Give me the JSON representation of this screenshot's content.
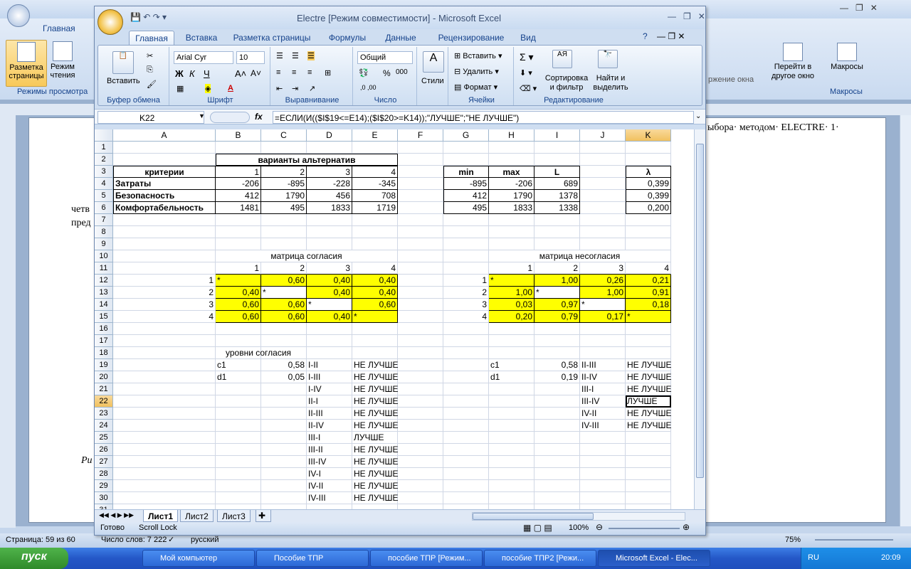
{
  "word": {
    "tab_home": "Главная",
    "layout_btn": "Разметка страницы",
    "reading_btn": "Режим чтения",
    "views_group": "Режимы просмотра",
    "goto_btn": "Перейти в другое окно",
    "window_fragment": "ржение окна",
    "macros_btn": "Макросы",
    "macros_group": "Макросы",
    "doc_text_right": "ыбора· методом· ELECTRE· 1·",
    "doc_text_left1": "четв",
    "doc_text_left2": "пред",
    "doc_text_ri": "Ри",
    "status_page": "Страница: 59 из 60",
    "status_words": "Число слов: 7 222",
    "status_lang": "русский",
    "zoom": "75%"
  },
  "excel": {
    "title": "Electre  [Режим совместимости] - Microsoft Excel",
    "tabs": [
      "Главная",
      "Вставка",
      "Разметка страницы",
      "Формулы",
      "Данные",
      "Рецензирование",
      "Вид"
    ],
    "ribbon": {
      "paste": "Вставить",
      "clipboard": "Буфер обмена",
      "font_name": "Arial Cyr",
      "font_size": "10",
      "font_group": "Шрифт",
      "align_group": "Выравнивание",
      "number_format": "Общий",
      "number_group": "Число",
      "styles": "Стили",
      "insert": "Вставить",
      "delete": "Удалить",
      "format": "Формат",
      "cells_group": "Ячейки",
      "sort": "Сортировка и фильтр",
      "find": "Найти и выделить",
      "edit_group": "Редактирование"
    },
    "name_box": "K22",
    "formula": "=ЕСЛИ(И(($I$19<=E14);($I$20>=K14));\"ЛУЧШЕ\";\"НЕ ЛУЧШЕ\")",
    "columns": [
      "A",
      "B",
      "C",
      "D",
      "E",
      "F",
      "G",
      "H",
      "I",
      "J",
      "K"
    ],
    "rows": [
      "1",
      "2",
      "3",
      "4",
      "5",
      "6",
      "7",
      "8",
      "9",
      "10",
      "11",
      "12",
      "13",
      "14",
      "15",
      "16",
      "17",
      "18",
      "19",
      "20",
      "21",
      "22",
      "23",
      "24",
      "25",
      "26",
      "27",
      "28",
      "29",
      "30",
      "31"
    ],
    "cells": {
      "B2": "варианты альтернатив",
      "A3": "критерии",
      "B3": "1",
      "C3": "2",
      "D3": "3",
      "E3": "4",
      "G3": "min",
      "H3": "max",
      "I3": "L",
      "K3": "λ",
      "A4": "Затраты",
      "B4": "-206",
      "C4": "-895",
      "D4": "-228",
      "E4": "-345",
      "G4": "-895",
      "H4": "-206",
      "I4": "689",
      "K4": "0,399",
      "A5": "Безопасность",
      "B5": "412",
      "C5": "1790",
      "D5": "456",
      "E5": "708",
      "G5": "412",
      "H5": "1790",
      "I5": "1378",
      "K5": "0,399",
      "A6": "Комфортабельность",
      "B6": "1481",
      "C6": "495",
      "D6": "1833",
      "E6": "1719",
      "G6": "495",
      "H6": "1833",
      "I6": "1338",
      "K6": "0,200",
      "C10": "матрица согласия",
      "I10": "матрица несогласия",
      "B11": "1",
      "C11": "2",
      "D11": "3",
      "E11": "4",
      "H11": "1",
      "I11": "2",
      "J11": "3",
      "K11": "4",
      "A12": "1",
      "B12": "*",
      "C12": "0,60",
      "D12": "0,40",
      "E12": "0,40",
      "G12": "1",
      "H12": "*",
      "I12": "1,00",
      "J12": "0,26",
      "K12": "0,21",
      "A13": "2",
      "B13": "0,40",
      "C13": "*",
      "D13": "0,40",
      "E13": "0,40",
      "G13": "2",
      "H13": "1,00",
      "I13": "*",
      "J13": "1,00",
      "K13": "0,91",
      "A14": "3",
      "B14": "0,60",
      "C14": "0,60",
      "D14": "*",
      "E14": "0,60",
      "G14": "3",
      "H14": "0,03",
      "I14": "0,97",
      "J14": "*",
      "K14": "0,18",
      "A15": "4",
      "B15": "0,60",
      "C15": "0,60",
      "D15": "0,40",
      "E15": "*",
      "G15": "4",
      "H15": "0,20",
      "I15": "0,79",
      "J15": "0,17",
      "K15": "*",
      "B18": "уровни согласия",
      "B19": "c1",
      "C19": "0,58",
      "D19": "I-II",
      "E19": "НЕ ЛУЧШЕ",
      "H19": "c1",
      "I19": "0,58",
      "J19": "II-III",
      "K19": "НЕ ЛУЧШЕ",
      "B20": "d1",
      "C20": "0,05",
      "D20": "I-III",
      "E20": "НЕ ЛУЧШЕ",
      "H20": "d1",
      "I20": "0,19",
      "J20": "II-IV",
      "K20": "НЕ ЛУЧШЕ",
      "D21": "I-IV",
      "E21": "НЕ ЛУЧШЕ",
      "J21": "III-I",
      "K21": "НЕ ЛУЧШЕ",
      "D22": "II-I",
      "E22": "НЕ ЛУЧШЕ",
      "J22": "III-IV",
      "K22": "ЛУЧШЕ",
      "D23": "II-III",
      "E23": "НЕ ЛУЧШЕ",
      "J23": "IV-II",
      "K23": "НЕ ЛУЧШЕ",
      "D24": "II-IV",
      "E24": "НЕ ЛУЧШЕ",
      "J24": "IV-III",
      "K24": "НЕ ЛУЧШЕ",
      "D25": "III-I",
      "E25": "ЛУЧШЕ",
      "D26": "III-II",
      "E26": "НЕ ЛУЧШЕ",
      "D27": "III-IV",
      "E27": "НЕ ЛУЧШЕ",
      "D28": "IV-I",
      "E28": "НЕ ЛУЧШЕ",
      "D29": "IV-II",
      "E29": "НЕ ЛУЧШЕ",
      "D30": "IV-III",
      "E30": "НЕ ЛУЧШЕ"
    },
    "sheets": [
      "Лист1",
      "Лист2",
      "Лист3"
    ],
    "status_ready": "Готово",
    "status_scroll": "Scroll Lock",
    "zoom": "100%",
    "highlight_color": "#ffff00"
  },
  "taskbar": {
    "start": "пуск",
    "items": [
      "Мой компьютер",
      "Пособие ТПР",
      "пособие ТПР [Режим...",
      "пособие ТПР2 [Режи...",
      "Microsoft Excel - Elec..."
    ],
    "lang": "RU",
    "time": "20:09"
  }
}
